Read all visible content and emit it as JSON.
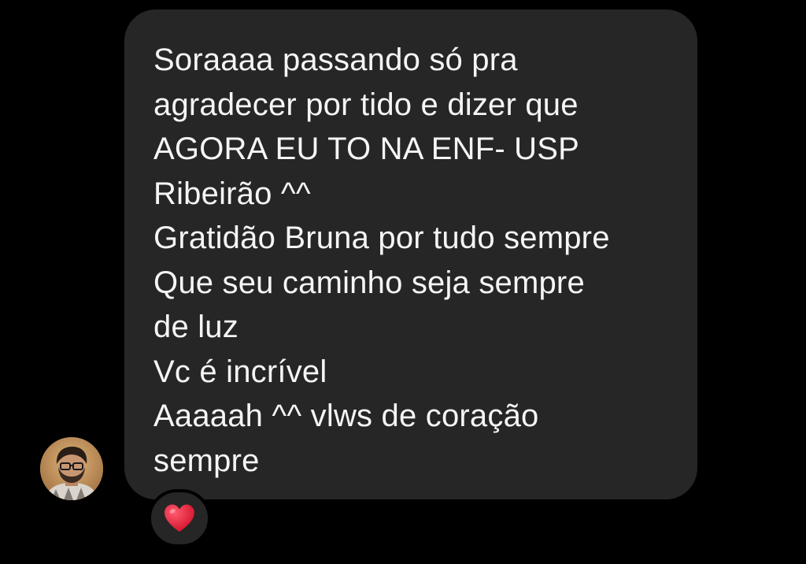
{
  "conversation": {
    "message": {
      "lines": [
        "Soraaaa passando só pra",
        "agradecer por tido e dizer que",
        "AGORA EU TO NA ENF- USP",
        "Ribeirão ^^",
        "Gratidão Bruna por tudo sempre",
        "Que seu caminho seja sempre",
        "de luz",
        "Vc é incrível",
        "Aaaaah ^^ vlws de coração",
        "sempre"
      ]
    },
    "reaction": {
      "icon": "heart-icon",
      "color": "#e3132f"
    }
  },
  "theme": {
    "background": "#000000",
    "bubble": "#262626",
    "text": "#f5f5f5"
  }
}
